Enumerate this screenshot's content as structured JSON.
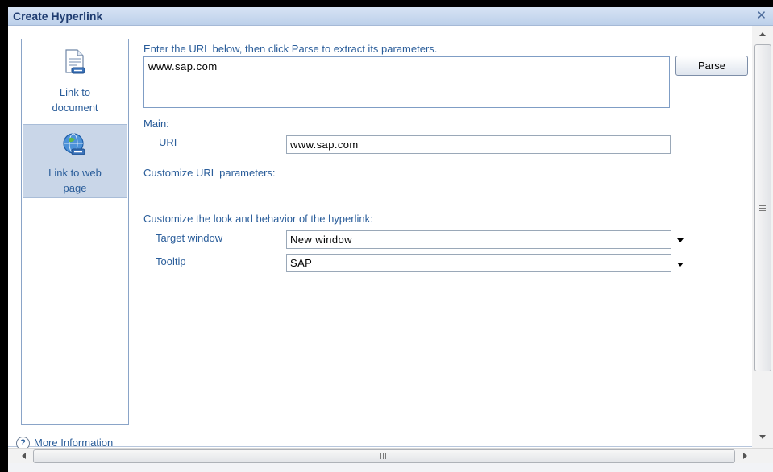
{
  "window": {
    "title": "Create Hyperlink",
    "close_glyph": "✕"
  },
  "nav": {
    "items": [
      {
        "label_line1": "Link to",
        "label_line2": "document",
        "icon": "document-link-icon",
        "selected": false
      },
      {
        "label_line1": "Link to web",
        "label_line2": "page",
        "icon": "web-link-icon",
        "selected": true
      }
    ]
  },
  "main": {
    "instruction": "Enter the URL below, then click Parse to extract its parameters.",
    "url_value": "www.sap.com",
    "parse_label": "Parse",
    "main_heading": "Main:",
    "uri_label": "URI",
    "uri_value": "www.sap.com",
    "customize_params_heading": "Customize URL parameters:",
    "customize_look_heading": "Customize the look and behavior of the hyperlink:",
    "target_window_label": "Target window",
    "target_window_value": "New window",
    "tooltip_label": "Tooltip",
    "tooltip_value": "SAP"
  },
  "footer": {
    "help_glyph": "?",
    "more_info_label": "More Information"
  },
  "colors": {
    "accent_text": "#2a5d9a",
    "title_text": "#1f3c70",
    "selected_nav": "#c9d6e8"
  }
}
